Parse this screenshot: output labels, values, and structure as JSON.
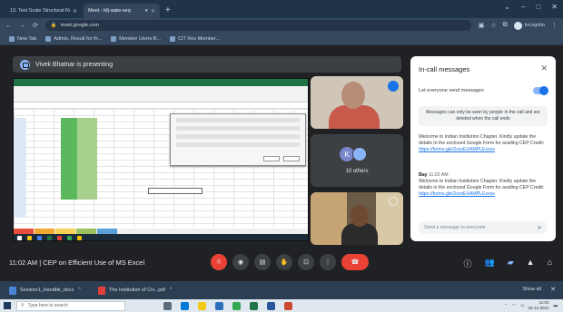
{
  "browser": {
    "tabs": [
      {
        "title": "13. Test Scale Structural Research",
        "active": false
      },
      {
        "title": "Meet - bfj-aqiw-seq",
        "active": true
      }
    ],
    "url": "meet.google.com",
    "profile_label": "Incognito",
    "bookmarks": [
      "New Tab",
      "Admin, Result for th...",
      "Member Users B...",
      "CIT Res Member..."
    ]
  },
  "meet": {
    "presenting_banner": "Vivek Bhatnar is presenting",
    "others_label": "10 others",
    "others_initial": "K",
    "meeting_time": "11:02 AM",
    "meeting_separator": "|",
    "meeting_name": "CEP on Efficient Use of MS Excel"
  },
  "panel": {
    "title": "In-call messages",
    "toggle_label": "Let everyone send messages",
    "info_text": "Messages can only be seen by people in the call and are deleted when the call ends",
    "message1_text": "Welcome to Indian Institution Chapter. Kindly update the details in the enclosed Google Form for availing CEP Credit:",
    "message1_link": "https://forms.gle/2xxxEXAMPLExxxx",
    "message2_sender": "Bay",
    "message2_time": "11:02 AM",
    "message2_text": "Welcome to Indian Institution Chapter. Kindly update the details in the enclosed Google Form for availing CEP Credit:",
    "message2_link": "https://forms.gle/2xxxEXAMPLExxxx",
    "input_placeholder": "Send a message to everyone"
  },
  "downloads": {
    "items": [
      "Session1_Handbk_docx",
      "The Institution of Civ...pdf"
    ],
    "show_all": "Show all"
  },
  "taskbar": {
    "search_placeholder": "Type here to search",
    "time": "11:02",
    "date": "20-12-2021"
  },
  "colors": {
    "meet_bg": "#202124",
    "accent": "#1a73e8",
    "end_call": "#ea4335",
    "excel_green": "#217346"
  }
}
